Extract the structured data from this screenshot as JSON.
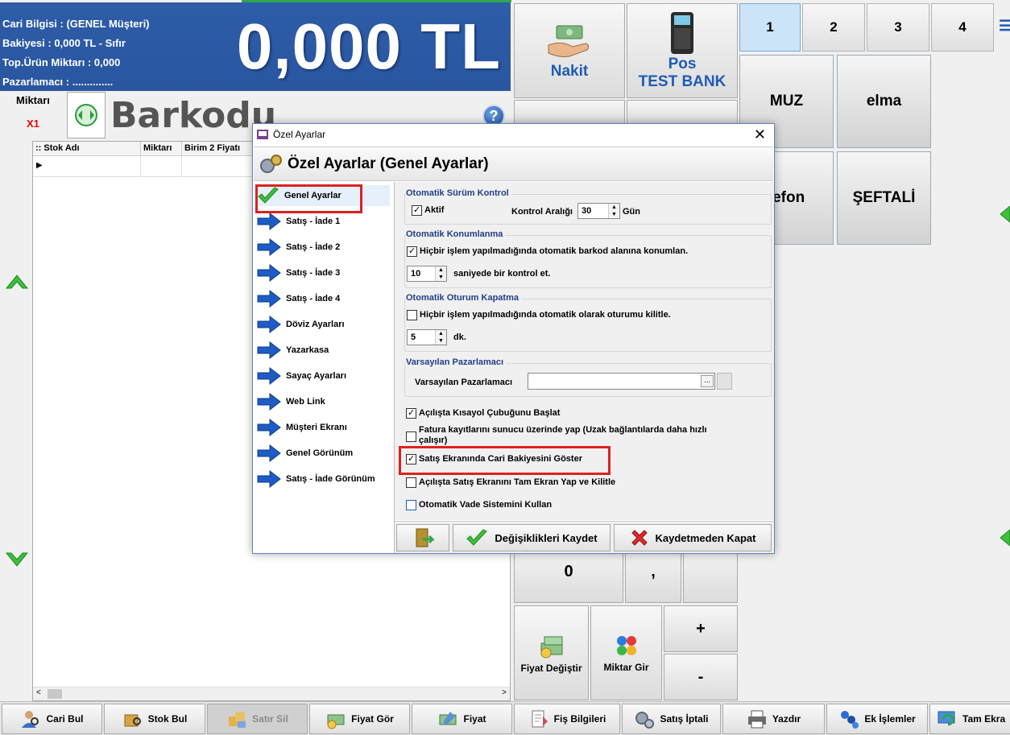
{
  "info": {
    "cari_bilgisi": "Cari Bilgisi : (GENEL Müşteri)",
    "bakiyesi": "Bakiyesi : 0,000 TL - Sıfır",
    "top_urun": "Top.Ürün Miktarı : 0,000",
    "pazarlamaci": "Pazarlamacı : ..............",
    "amount": "0,000 TL"
  },
  "entry": {
    "miktar_label": "Miktarı",
    "multiplier": "X1",
    "barcode_label": "Barkodu",
    "help": "?"
  },
  "grid": {
    "columns": [
      ":: Stok Adı",
      "Miktarı",
      "Birim 2 Fiyatı"
    ]
  },
  "payment": {
    "nakit": "Nakit",
    "pos_line1": "Pos",
    "pos_line2": "TEST BANK"
  },
  "tabs": [
    "1",
    "2",
    "3",
    "4"
  ],
  "products": [
    "MUZ",
    "elma",
    "lefon",
    "ŞEFTALİ"
  ],
  "keypad": {
    "zero": "0",
    "comma": ",",
    "plus": "+",
    "minus": "-",
    "fiyat_degistir": "Fiyat Değiştir",
    "miktar_gir": "Miktar Gir"
  },
  "bottom": {
    "items": [
      "Cari Bul",
      "Stok Bul",
      "Satır Sil",
      "Fiyat Gör",
      "Fiyat",
      "Fiş Bilgileri",
      "Satış İptali",
      "Yazdır",
      "Ek İşlemler",
      "Tam Ekra"
    ]
  },
  "dialog": {
    "title": "Özel Ayarlar",
    "header": "Özel Ayarlar (Genel Ayarlar)",
    "nav": [
      "Genel Ayarlar",
      "Satış - İade 1",
      "Satış - İade 2",
      "Satış - İade 3",
      "Satış - İade 4",
      "Döviz Ayarları",
      "Yazarkasa",
      "Sayaç Ayarları",
      "Web Link",
      "Müşteri Ekranı",
      "Genel Görünüm",
      "Satış - İade Görünüm"
    ],
    "g1_title": "Otomatik Sürüm Kontrol",
    "g1_aktif": "Aktif",
    "g1_interval_label": "Kontrol Aralığı",
    "g1_interval_value": "30",
    "g1_unit": "Gün",
    "g2_title": "Otomatik Konumlanma",
    "g2_check": "Hiçbir işlem yapılmadığında otomatik barkod alanına konumlan.",
    "g2_value": "10",
    "g2_suffix": "saniyede bir kontrol et.",
    "g3_title": "Otomatik Oturum Kapatma",
    "g3_check": "Hiçbir işlem yapılmadığında otomatik olarak oturumu kilitle.",
    "g3_value": "5",
    "g3_suffix": "dk.",
    "g4_title": "Varsayılan Pazarlamacı",
    "g4_label": "Varsayılan Pazarlamacı",
    "g4_value": "",
    "c1": "Açılışta Kısayol Çubuğunu Başlat",
    "c2": "Fatura kayıtlarını sunucu üzerinde yap (Uzak bağlantılarda daha hızlı çalışır)",
    "c3": "Satış Ekranında Cari Bakiyesini Göster",
    "c4": "Açılışta Satış Ekranını Tam Ekran Yap ve Kilitle",
    "c5": "Otomatik Vade Sistemini Kullan",
    "save": "Değişiklikleri Kaydet",
    "close": "Kaydetmeden Kapat",
    "ellipsis": "..."
  }
}
